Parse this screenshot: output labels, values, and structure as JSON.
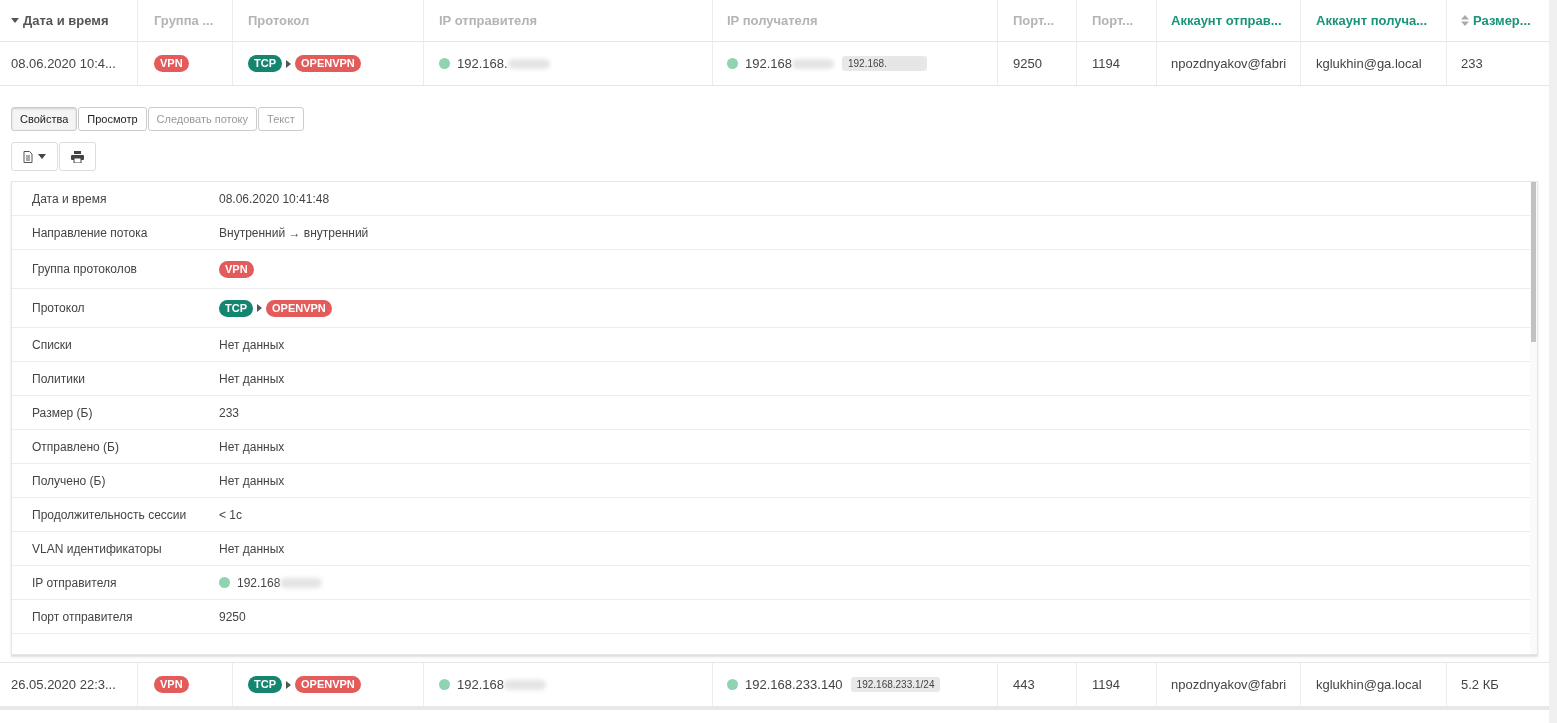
{
  "columns": [
    {
      "label": "Дата и время",
      "kind": "plain",
      "sorted": true,
      "accent": false
    },
    {
      "label": "Группа ...",
      "kind": "plain",
      "sorted": false,
      "accent": false
    },
    {
      "label": "Протокол",
      "kind": "plain",
      "sorted": false,
      "accent": false
    },
    {
      "label": "IP отправителя",
      "kind": "plain",
      "sorted": false,
      "accent": false
    },
    {
      "label": "IP получателя",
      "kind": "plain",
      "sorted": false,
      "accent": false
    },
    {
      "label": "Порт...",
      "kind": "plain",
      "sorted": false,
      "accent": false
    },
    {
      "label": "Порт...",
      "kind": "plain",
      "sorted": false,
      "accent": false
    },
    {
      "label": "Аккаунт отправ...",
      "kind": "plain",
      "sorted": false,
      "accent": true
    },
    {
      "label": "Аккаунт получа...",
      "kind": "plain",
      "sorted": false,
      "accent": true
    },
    {
      "label": "Размер...",
      "kind": "sortable",
      "sorted": false,
      "accent": true
    }
  ],
  "rows": [
    {
      "expanded": true,
      "date": "08.06.2020 10:4...",
      "group": {
        "label": "VPN",
        "color": "#e45b5b"
      },
      "protocol": [
        {
          "label": "TCP",
          "color": "#14856f"
        },
        {
          "label": "OPENVPN",
          "color": "#e45b5b"
        }
      ],
      "src_ip": {
        "text": "192.168.",
        "redacted": true
      },
      "dst_ip": {
        "text": "192.168",
        "redacted": true,
        "subnet": {
          "text": "192.168.",
          "redacted": true
        }
      },
      "src_port": "9250",
      "dst_port": "1194",
      "src_account": "npozdnyakov@fabri",
      "dst_account": "kglukhin@ga.local",
      "size": "233"
    },
    {
      "expanded": false,
      "date": "26.05.2020 22:3...",
      "group": {
        "label": "VPN",
        "color": "#e45b5b"
      },
      "protocol": [
        {
          "label": "TCP",
          "color": "#14856f"
        },
        {
          "label": "OPENVPN",
          "color": "#e45b5b"
        }
      ],
      "src_ip": {
        "text": "192.168",
        "redacted": true
      },
      "dst_ip": {
        "text": "192.168.233.140",
        "redacted": false,
        "subnet": {
          "text": "192.168.233.1/24",
          "redacted": false
        }
      },
      "src_port": "443",
      "dst_port": "1194",
      "src_account": "npozdnyakov@fabri",
      "dst_account": "kglukhin@ga.local",
      "size": "5.2 КБ"
    }
  ],
  "details": {
    "tabs": [
      {
        "label": "Свойства",
        "selected": true,
        "disabled": false
      },
      {
        "label": "Просмотр",
        "selected": false,
        "disabled": false
      },
      {
        "label": "Следовать потоку",
        "selected": false,
        "disabled": true
      },
      {
        "label": "Текст",
        "selected": false,
        "disabled": true
      }
    ],
    "properties": [
      {
        "kind": "text",
        "label": "Дата и время",
        "value": "08.06.2020 10:41:48"
      },
      {
        "kind": "text",
        "label": "Направление потока",
        "value": "Внутренний → внутренний"
      },
      {
        "kind": "tags",
        "label": "Группа протоколов",
        "tags": [
          {
            "label": "VPN",
            "color": "#e45b5b"
          }
        ]
      },
      {
        "kind": "tags",
        "label": "Протокол",
        "tags": [
          {
            "label": "TCP",
            "color": "#14856f"
          },
          {
            "label": "OPENVPN",
            "color": "#e45b5b"
          }
        ]
      },
      {
        "kind": "text",
        "label": "Списки",
        "value": "Нет данных"
      },
      {
        "kind": "text",
        "label": "Политики",
        "value": "Нет данных"
      },
      {
        "kind": "text",
        "label": "Размер (Б)",
        "value": "233"
      },
      {
        "kind": "text",
        "label": "Отправлено (Б)",
        "value": "Нет данных"
      },
      {
        "kind": "text",
        "label": "Получено (Б)",
        "value": "Нет данных"
      },
      {
        "kind": "text",
        "label": "Продолжительность сессии",
        "value": "< 1с"
      },
      {
        "kind": "text",
        "label": "VLAN идентификаторы",
        "value": "Нет данных"
      },
      {
        "kind": "ip",
        "label": "IP отправителя",
        "value": "192.168",
        "redacted": true
      },
      {
        "kind": "text",
        "label": "Порт отправителя",
        "value": "9250"
      }
    ]
  }
}
